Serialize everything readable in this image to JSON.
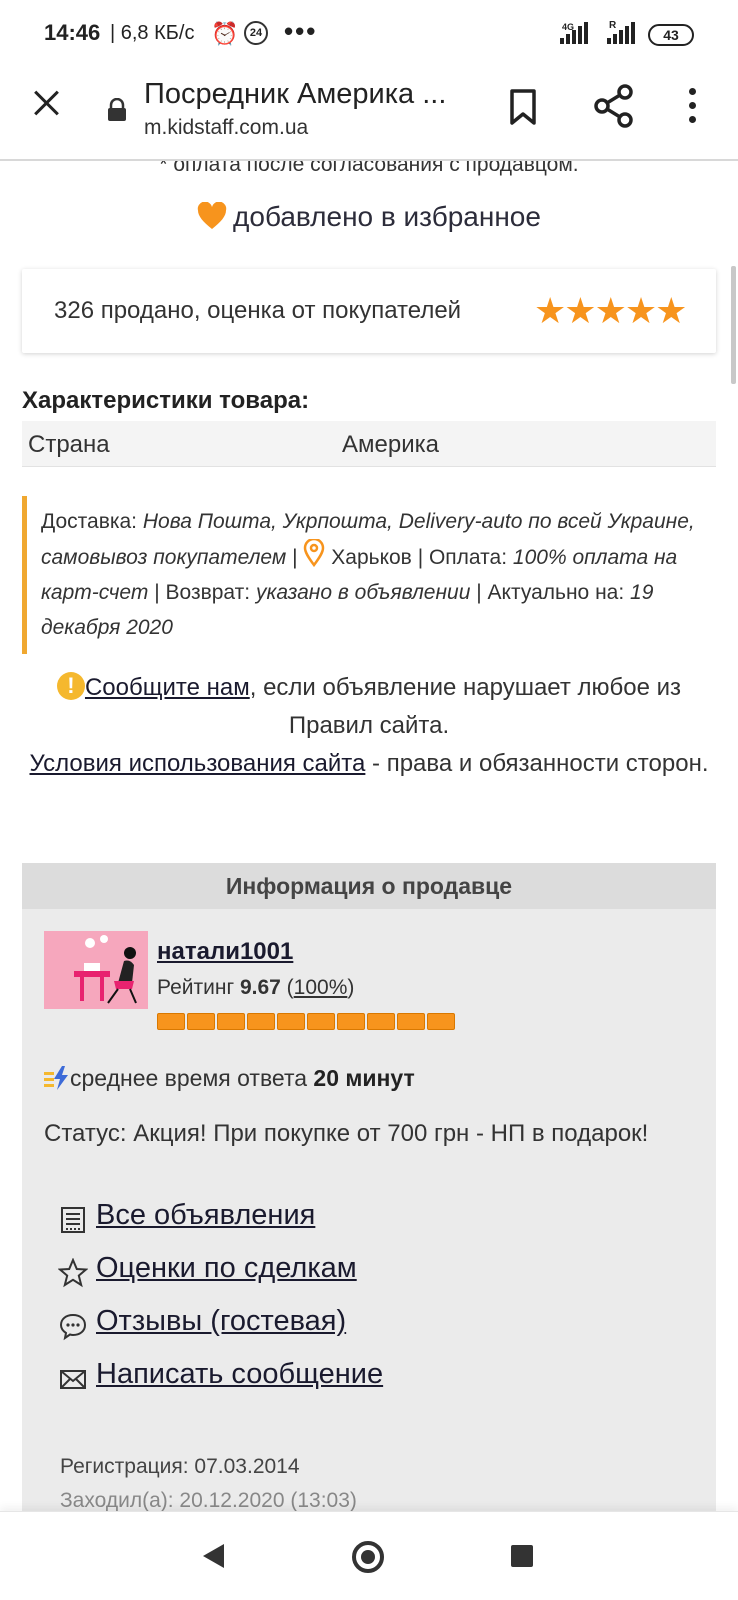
{
  "status_bar": {
    "time": "14:46",
    "speed": "| 6,8 КБ/с",
    "alarm_badge": "24",
    "more_dots": "•••",
    "network_4g": "4G",
    "roaming": "R",
    "battery": "43"
  },
  "browser": {
    "title": "Посредник Америка ...",
    "url": "m.kidstaff.com.ua"
  },
  "page": {
    "payment_note": "* оплата после согласования с продавцом.",
    "favorite_text": "добавлено в избранное",
    "rating_summary": "326 продано, оценка от покупателей",
    "stars_count": 5,
    "specs_title": "Характеристики товара:",
    "specs": [
      {
        "key": "Страна",
        "value": "Америка"
      }
    ],
    "delivery": {
      "label_delivery": "Доставка:",
      "delivery_methods": "Нова Пошта, Укрпошта, Delivery-auto по всей Украине, самовывоз покупателем",
      "sep1": "|",
      "city": "Харьков",
      "label_payment": "| Оплата:",
      "payment": "100% оплата на карт-счет",
      "label_return": "| Возврат:",
      "return": "указано в объявлении",
      "label_actual": "| Актуально на:",
      "actual_date": "19 декабря 2020"
    },
    "report": {
      "link": "Сообщите нам",
      "text": ", если объявление нарушает любое из Правил сайта.",
      "terms_link": "Условия использования сайта",
      "terms_text": " - права и обязанности сторон."
    }
  },
  "seller": {
    "header": "Информация о продавце",
    "name": "натали1001",
    "rating_label": "Рейтинг",
    "rating_value": "9.67",
    "rating_percent": "100%",
    "rating_fraction": 1.0,
    "response_text": "среднее время ответа",
    "response_time": "20 минут",
    "status": "Статус: Акция! При покупке от 700 грн - НП в подарок!",
    "links": [
      {
        "label": "Все объявления",
        "icon": "listing-icon"
      },
      {
        "label": "Оценки по сделкам",
        "icon": "star-outline-icon"
      },
      {
        "label": "Отзывы (гостевая)",
        "icon": "chat-icon"
      },
      {
        "label": "Написать сообщение",
        "icon": "envelope-icon"
      }
    ],
    "registration": "Регистрация: 07.03.2014",
    "last_visit": "Заходил(а): 20.12.2020 (13:03)"
  },
  "colors": {
    "accent": "#f7941d",
    "border_accent": "#f0a830",
    "link": "#1a1a2e"
  }
}
